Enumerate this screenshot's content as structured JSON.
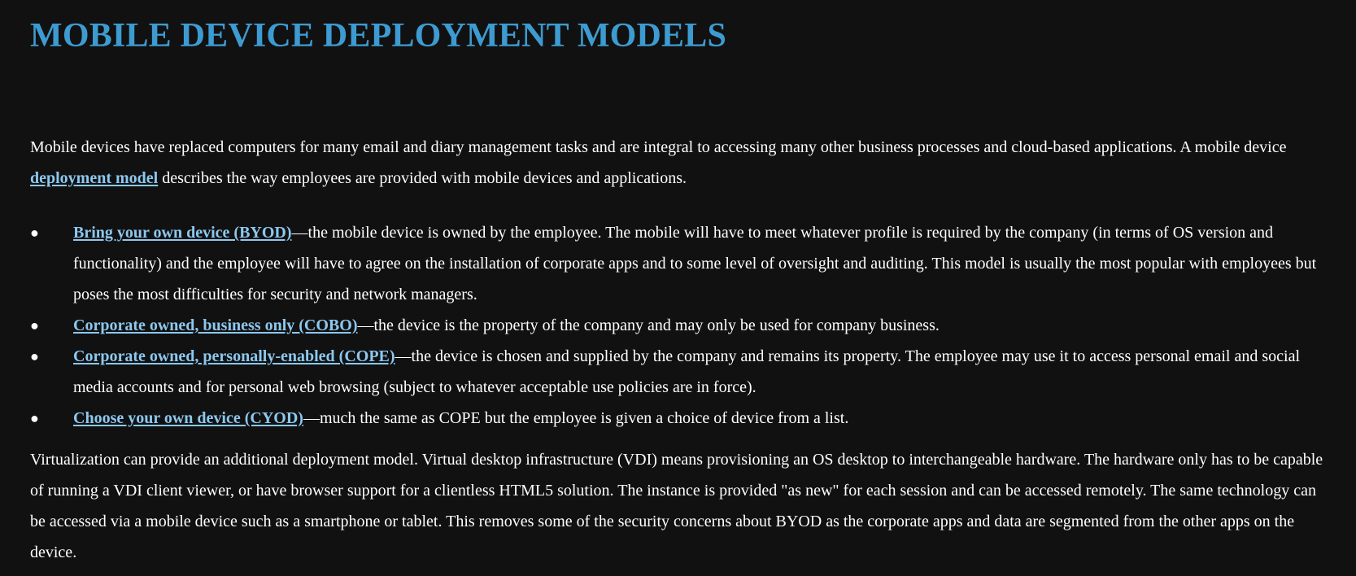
{
  "title": "MOBILE DEVICE DEPLOYMENT MODELS",
  "intro": {
    "before": "Mobile devices have replaced computers for many email and diary management tasks and are integral to accessing many other business processes and cloud-based applications. A mobile device ",
    "link": "deployment model",
    "after": " describes the way employees are provided with mobile devices and applications."
  },
  "bullet_glyph": "●",
  "models": [
    {
      "link": "Bring your own device (BYOD)",
      "text": "—the mobile device is owned by the employee. The mobile will have to meet whatever profile is required by the company (in terms of OS version and functionality) and the employee will have to agree on the installation of corporate apps and to some level of oversight and auditing. This model is usually the most popular with employees but poses the most difficulties for security and network managers."
    },
    {
      "link": "Corporate owned, business only (COBO)",
      "text": "—the device is the property of the company and may only be used for company business."
    },
    {
      "link": "Corporate owned, personally-enabled (COPE)",
      "text": "—the device is chosen and supplied by the company and remains its property. The employee may use it to access personal email and social media accounts and for personal web browsing (subject to whatever acceptable use policies are in force)."
    },
    {
      "link": "Choose your own device (CYOD)",
      "text": "—much the same as COPE but the employee is given a choice of device from a list."
    }
  ],
  "vdi_paragraph": "Virtualization can provide an additional deployment model. Virtual desktop infrastructure (VDI) means provisioning an OS desktop to interchangeable hardware. The hardware only has to be capable of running a VDI client viewer, or have browser support for a clientless HTML5 solution. The instance is provided \"as new\" for each session and can be accessed remotely. The same technology can be accessed via a mobile device such as a smartphone or tablet. This removes some of the security concerns about BYOD as the corporate apps and data are segmented from the other apps on the device.",
  "colors": {
    "background": "#111111",
    "heading": "#3d9bd1",
    "link": "#8cc8ef",
    "text": "#ffffff"
  }
}
